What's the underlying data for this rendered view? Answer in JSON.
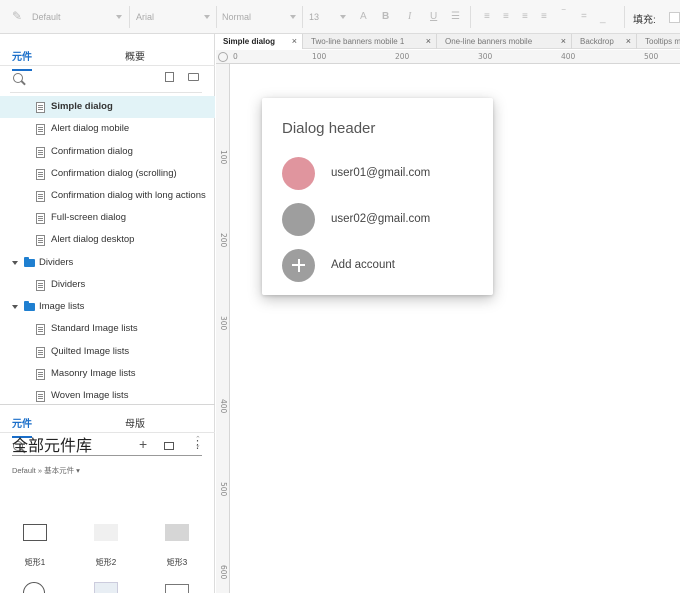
{
  "toolbar": {
    "style_select": "Default",
    "font_select": "Arial",
    "weight_select": "Normal",
    "size_select": "13",
    "fill_label": "填充:"
  },
  "panel_top": {
    "tabs": [
      "元件",
      "概要"
    ],
    "items": [
      {
        "label": "Simple dialog",
        "type": "page",
        "selected": true
      },
      {
        "label": "Alert dialog mobile",
        "type": "page"
      },
      {
        "label": "Confirmation dialog",
        "type": "page"
      },
      {
        "label": "Confirmation dialog (scrolling)",
        "type": "page"
      },
      {
        "label": "Confirmation dialog with long actions",
        "type": "page"
      },
      {
        "label": "Full-screen dialog",
        "type": "page"
      },
      {
        "label": "Alert dialog desktop",
        "type": "page"
      },
      {
        "label": "Dividers",
        "type": "folder"
      },
      {
        "label": "Dividers",
        "type": "page"
      },
      {
        "label": "Image lists",
        "type": "folder"
      },
      {
        "label": "Standard Image lists",
        "type": "page"
      },
      {
        "label": "Quilted Image lists",
        "type": "page"
      },
      {
        "label": "Masonry Image lists",
        "type": "page"
      },
      {
        "label": "Woven Image lists",
        "type": "page"
      }
    ]
  },
  "panel_bottom": {
    "tabs": [
      "元件",
      "母版"
    ],
    "library_title": "全部元件库",
    "library_sub": "Default » 基本元件 ▾",
    "widgets": [
      {
        "label": "矩形1",
        "fill": "#ffffff",
        "border": "#555555"
      },
      {
        "label": "矩形2",
        "fill": "#f0f0f0",
        "border": "#f0f0f0"
      },
      {
        "label": "矩形3",
        "fill": "#d6d6d6",
        "border": "#d6d6d6"
      }
    ]
  },
  "doc_tabs": [
    {
      "label": "Simple dialog",
      "active": true
    },
    {
      "label": "Two-line banners mobile 1"
    },
    {
      "label": "One-line banners mobile"
    },
    {
      "label": "Backdrop"
    },
    {
      "label": "Tooltips m"
    }
  ],
  "ruler": {
    "h_ticks": [
      "0",
      "100",
      "200",
      "300",
      "400",
      "500"
    ],
    "v_ticks": [
      "100",
      "200",
      "300",
      "400",
      "500",
      "600"
    ]
  },
  "dialog": {
    "header": "Dialog header",
    "accounts": [
      {
        "email": "user01@gmail.com",
        "avatar_color": "#e0959e"
      },
      {
        "email": "user02@gmail.com",
        "avatar_color": "#9e9e9e"
      }
    ],
    "add_label": "Add account",
    "add_color": "#9e9e9e"
  }
}
